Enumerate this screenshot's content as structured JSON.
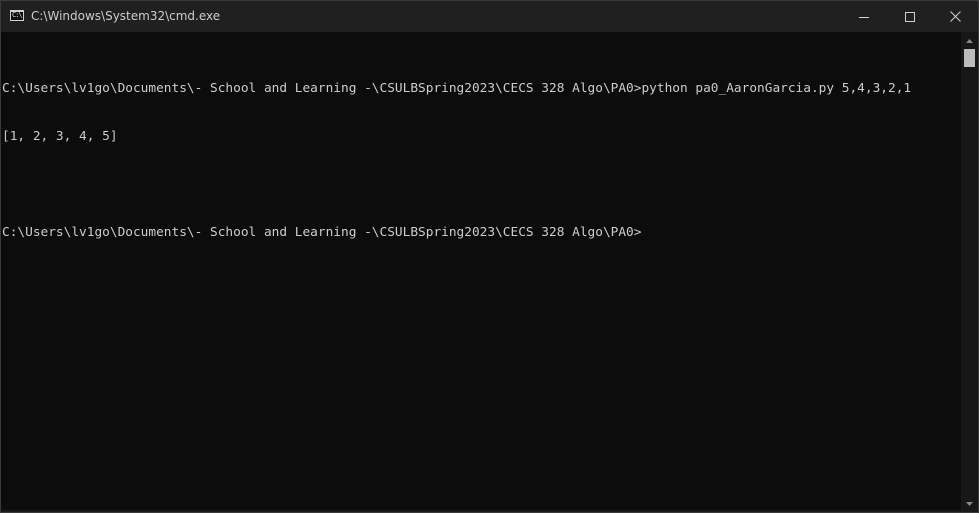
{
  "window": {
    "title": "C:\\Windows\\System32\\cmd.exe",
    "icon": "cmd-prompt-icon",
    "icon_glyph": "C:\\"
  },
  "controls": {
    "minimize_icon": "minimize-icon",
    "maximize_icon": "maximize-icon",
    "close_icon": "close-icon"
  },
  "console": {
    "lines": [
      "C:\\Users\\lv1go\\Documents\\- School and Learning -\\CSULBSpring2023\\CECS 328 Algo\\PA0>python pa0_AaronGarcia.py 5,4,3,2,1",
      "[1, 2, 3, 4, 5]",
      "",
      "C:\\Users\\lv1go\\Documents\\- School and Learning -\\CSULBSpring2023\\CECS 328 Algo\\PA0>"
    ],
    "text_color": "#cccccc",
    "background_color": "#0c0c0c"
  },
  "scrollbar": {
    "up_icon": "scroll-up-arrow-icon",
    "down_icon": "scroll-down-arrow-icon"
  }
}
